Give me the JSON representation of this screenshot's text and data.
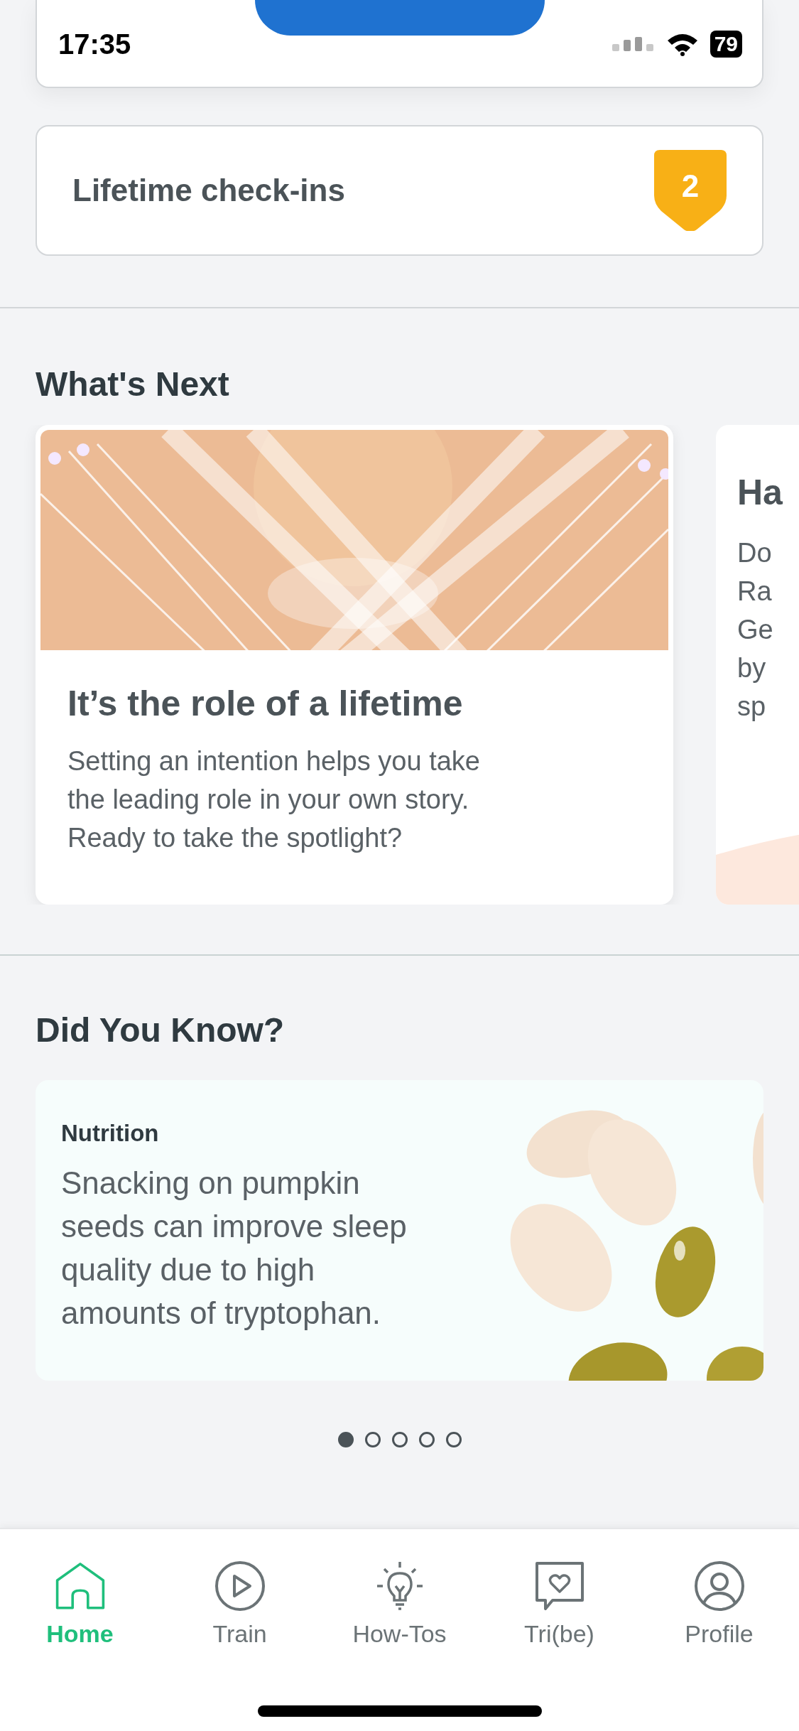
{
  "status_bar": {
    "time": "17:35",
    "battery": "79"
  },
  "check_in_card": {
    "kind": "button"
  },
  "lifetime": {
    "label": "Lifetime check-ins",
    "count": "2"
  },
  "whats_next": {
    "title": "What's Next",
    "cards": [
      {
        "kind": "picture",
        "title": "It’s the role of a lifetime",
        "body": "Setting an intention helps you take the leading role in your own story. Ready to take the spotlight?"
      },
      {
        "kind": "partial",
        "title": "Ha",
        "lines": [
          "Do",
          "Ra",
          "Ge",
          "by",
          "sp"
        ]
      }
    ]
  },
  "did_you_know": {
    "title": "Did You Know?",
    "category": "Nutrition",
    "text": "Snacking on pumpkin seeds can improve sleep quality due to high amounts of tryptophan.",
    "pages": [
      {
        "selected": true
      },
      {
        "selected": false
      },
      {
        "selected": false
      },
      {
        "selected": false
      },
      {
        "selected": false
      }
    ]
  },
  "tab_bar": [
    {
      "label": "Home",
      "selected": true
    },
    {
      "label": "Train",
      "selected": false
    },
    {
      "label": "How-Tos",
      "selected": false
    },
    {
      "label": "Tri(be)",
      "selected": false
    },
    {
      "label": "Profile",
      "selected": false
    }
  ]
}
